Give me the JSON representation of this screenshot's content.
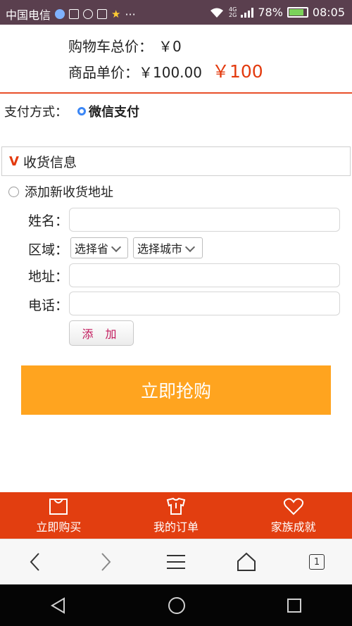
{
  "status_bar": {
    "carrier": "中国电信",
    "network_type_top": "4G",
    "network_type_bottom": "2G",
    "battery_percent": "78%",
    "time": "08:05",
    "more": "···"
  },
  "cart": {
    "total_label": "购物车总价：",
    "total_value": "￥0",
    "unit_label": "商品单价：",
    "unit_original": "￥100.00",
    "unit_sale": "￥100"
  },
  "payment": {
    "label": "支付方式：",
    "method": "微信支付"
  },
  "shipping": {
    "section_title": "收货信息",
    "add_new": "添加新收货地址",
    "name_label": "姓名：",
    "region_label": "区域：",
    "province_select": "选择省",
    "city_select": "选择城市",
    "address_label": "地址：",
    "phone_label": "电话：",
    "add_button": "添 加"
  },
  "buy_button": "立即抢购",
  "tabbar": {
    "items": [
      {
        "label": "立即购买",
        "icon": "shopping-bag-icon"
      },
      {
        "label": "我的订单",
        "icon": "shirt-icon"
      },
      {
        "label": "家族成就",
        "icon": "heart-icon"
      }
    ]
  },
  "browser": {
    "tab_count": "1",
    "icons": [
      "back-icon",
      "forward-icon",
      "menu-icon",
      "home-icon",
      "tabs-icon"
    ]
  },
  "system_nav": {
    "icons": [
      "back-triangle-icon",
      "home-circle-icon",
      "recents-square-icon"
    ]
  },
  "colors": {
    "accent_red": "#e23e10",
    "price_red": "#e33a0e",
    "buy_orange": "#ffa41f",
    "radio_blue": "#3b86f5",
    "status_bar": "#5a3f4e"
  }
}
